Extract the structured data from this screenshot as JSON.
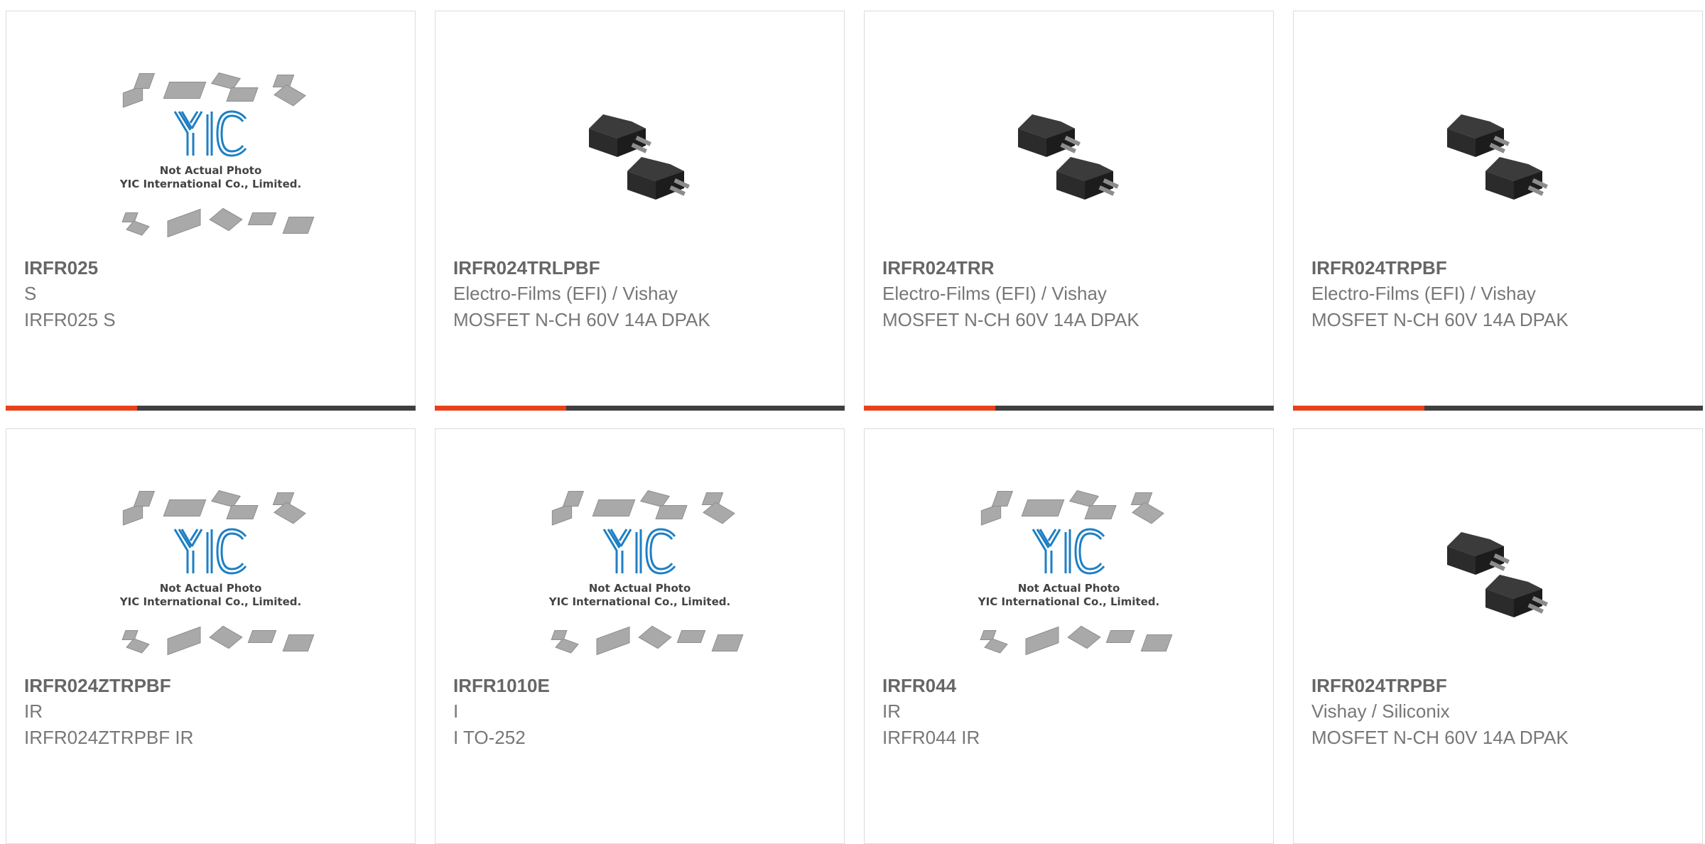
{
  "colors": {
    "accent": "#e8411a",
    "bar": "#3f3f3f",
    "logo_blue": "#1e7fc4"
  },
  "placeholder": {
    "logo_text": "YIC",
    "caption_1": "Not Actual Photo",
    "caption_2": "YIC International Co., Limited."
  },
  "products": [
    {
      "name": "IRFR025",
      "manufacturer": "S",
      "description": "IRFR025 S",
      "image": "placeholder",
      "progress_fraction": 0.32
    },
    {
      "name": "IRFR024TRLPBF",
      "manufacturer": "Electro-Films (EFI) / Vishay",
      "description": "MOSFET N-CH 60V 14A DPAK",
      "image": "dpak-photo",
      "progress_fraction": 0.32
    },
    {
      "name": "IRFR024TRR",
      "manufacturer": "Electro-Films (EFI) / Vishay",
      "description": "MOSFET N-CH 60V 14A DPAK",
      "image": "dpak-photo",
      "progress_fraction": 0.32
    },
    {
      "name": "IRFR024TRPBF",
      "manufacturer": "Electro-Films (EFI) / Vishay",
      "description": "MOSFET N-CH 60V 14A DPAK",
      "image": "dpak-photo",
      "progress_fraction": 0.32
    },
    {
      "name": "IRFR024ZTRPBF",
      "manufacturer": "IR",
      "description": "IRFR024ZTRPBF IR",
      "image": "placeholder"
    },
    {
      "name": "IRFR1010E",
      "manufacturer": "I",
      "description": "I TO-252",
      "image": "placeholder"
    },
    {
      "name": "IRFR044",
      "manufacturer": "IR",
      "description": "IRFR044 IR",
      "image": "placeholder"
    },
    {
      "name": "IRFR024TRPBF",
      "manufacturer": "Vishay / Siliconix",
      "description": "MOSFET N-CH 60V 14A DPAK",
      "image": "dpak-photo"
    }
  ]
}
